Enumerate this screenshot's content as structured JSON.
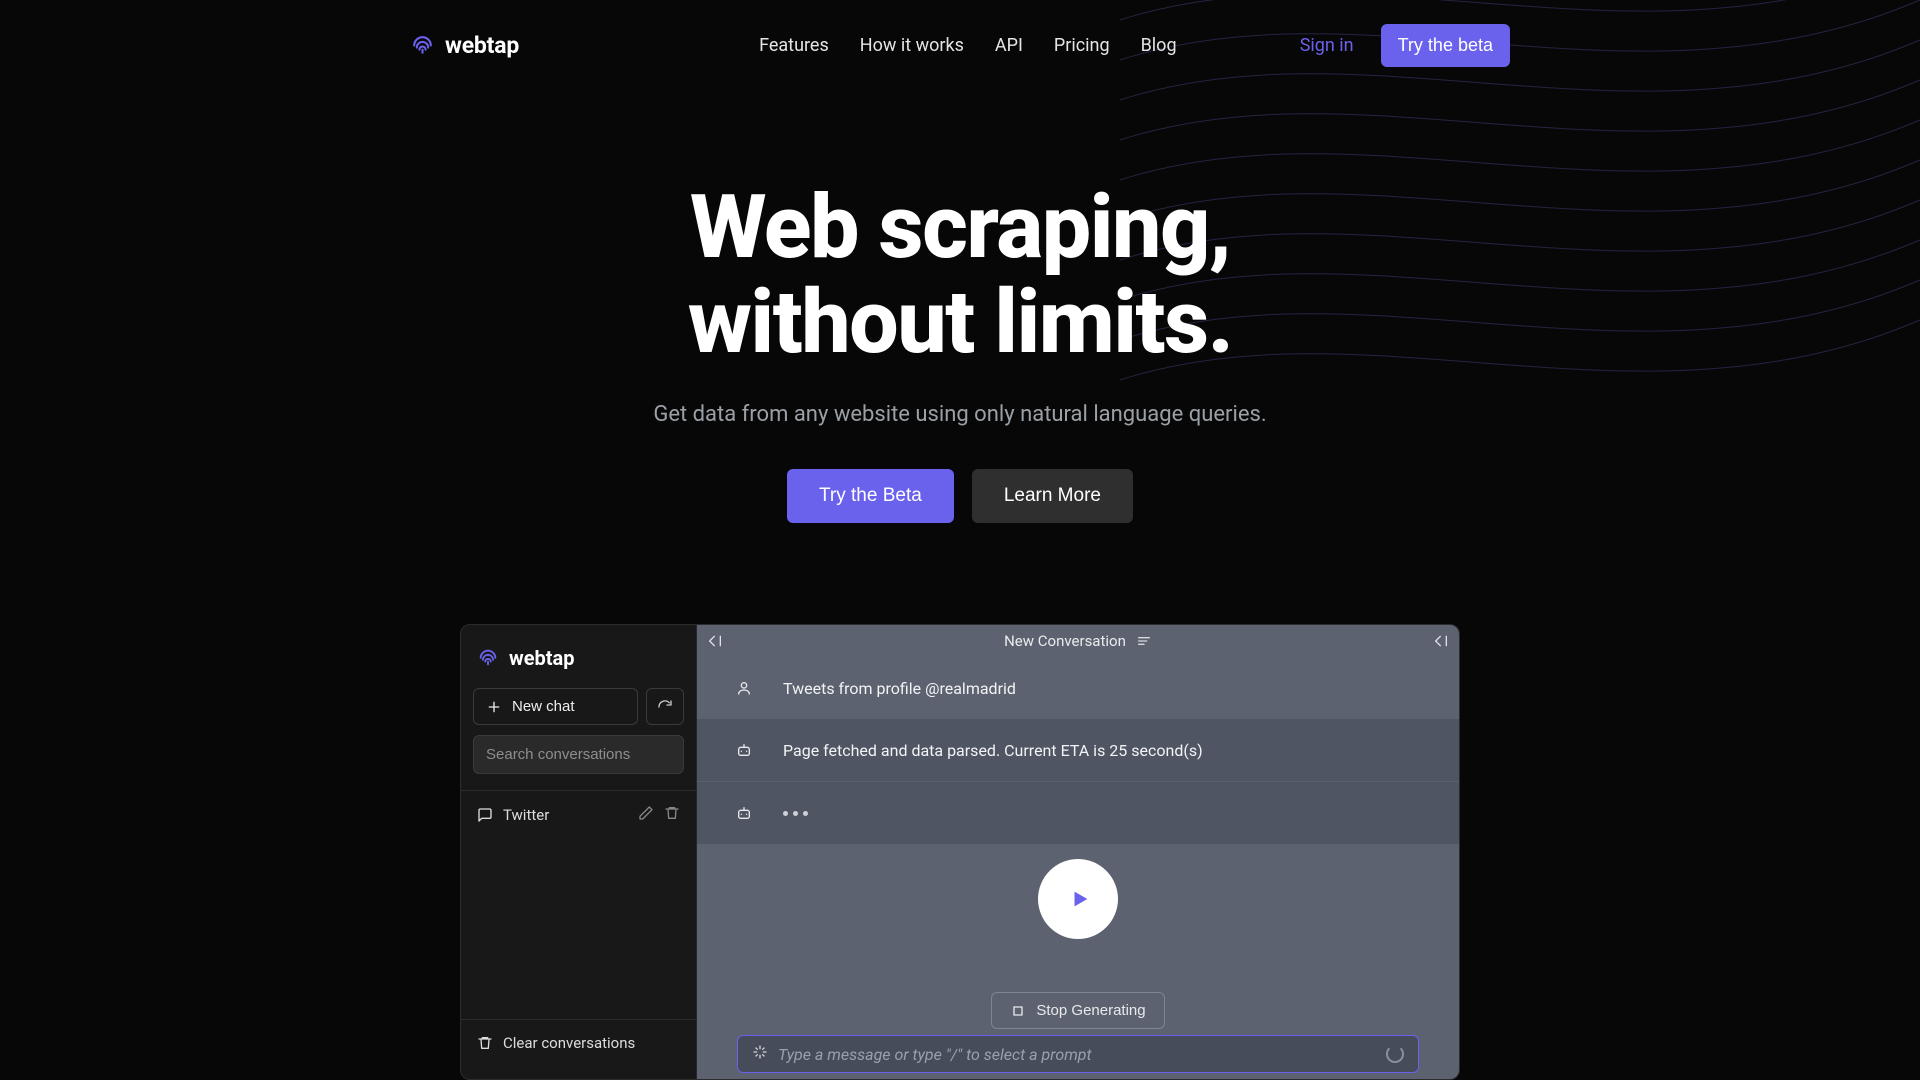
{
  "brand": "webtap",
  "nav": {
    "links": [
      "Features",
      "How it works",
      "API",
      "Pricing",
      "Blog"
    ],
    "signin": "Sign in",
    "cta": "Try the beta"
  },
  "hero": {
    "title_line1": "Web scraping,",
    "title_line2": "without limits.",
    "subtitle": "Get data from any website using only natural language queries.",
    "primary": "Try the Beta",
    "secondary": "Learn More"
  },
  "preview": {
    "sidebar": {
      "newchat": "New chat",
      "search_placeholder": "Search conversations",
      "conversations": [
        {
          "label": "Twitter"
        }
      ],
      "clear": "Clear conversations"
    },
    "main": {
      "title": "New Conversation",
      "messages": [
        {
          "role": "user",
          "text": "Tweets from profile @realmadrid"
        },
        {
          "role": "bot",
          "text": "Page fetched and data parsed. Current ETA is 25 second(s)"
        },
        {
          "role": "bot",
          "text": ""
        }
      ],
      "stop": "Stop Generating",
      "input_placeholder": "Type a message or type \"/\" to select a prompt"
    }
  },
  "colors": {
    "accent": "#6A62EC"
  }
}
